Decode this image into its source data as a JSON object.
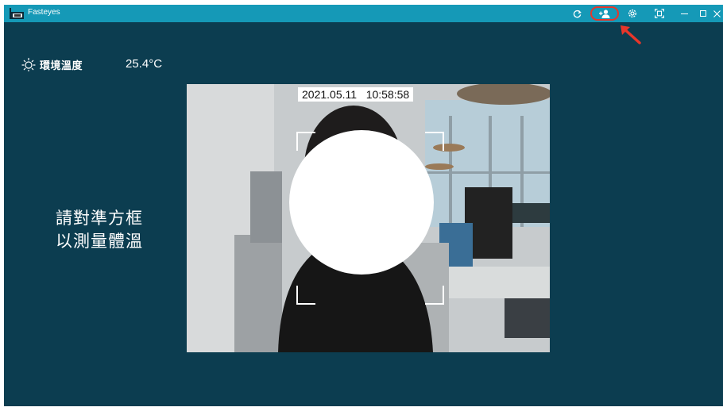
{
  "app": {
    "title": "Fasteyes"
  },
  "toolbar": {
    "buttons": [
      {
        "name": "refresh",
        "icon": "refresh-icon"
      },
      {
        "name": "add-user",
        "icon": "add-user-icon",
        "highlighted": true
      },
      {
        "name": "settings",
        "icon": "gear-icon"
      },
      {
        "name": "capture",
        "icon": "face-scan-icon"
      },
      {
        "name": "minimize",
        "icon": "minimize-icon"
      },
      {
        "name": "maximize",
        "icon": "maximize-icon"
      },
      {
        "name": "close",
        "icon": "close-icon"
      }
    ],
    "annotation_color": "#e7362a"
  },
  "environment": {
    "label": "環境溫度",
    "value": "25.4°C",
    "icon": "sun-icon"
  },
  "prompt": {
    "line1": "請對準方框",
    "line2": "以測量體溫"
  },
  "camera": {
    "timestamp": "2021.05.11   10:58:58"
  },
  "colors": {
    "background": "#0c3d50",
    "titlebar": "#1599b7",
    "text": "#ffffff"
  }
}
